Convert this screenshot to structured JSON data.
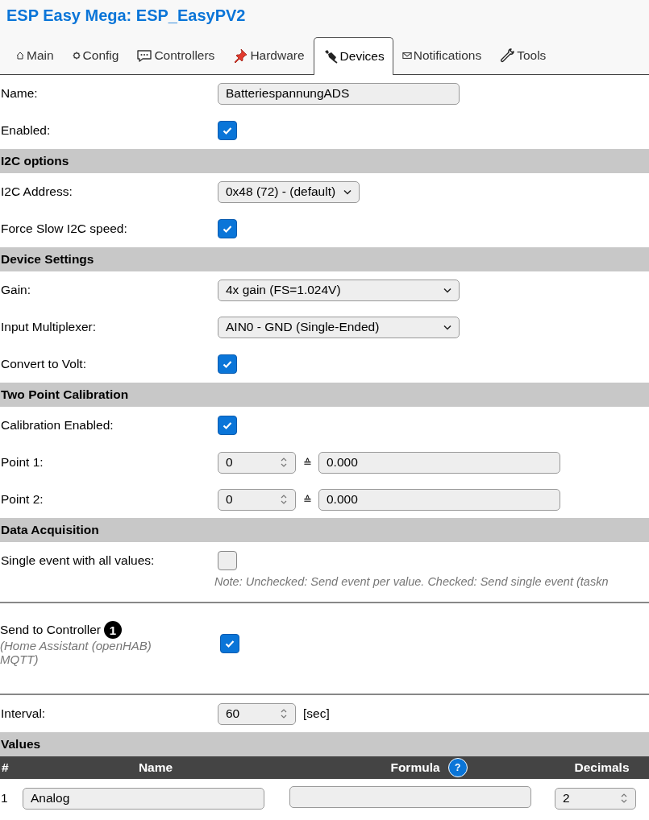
{
  "title": "ESP Easy Mega: ESP_EasyPV2",
  "tabs": [
    {
      "label": "Main",
      "selected": false
    },
    {
      "label": "Config",
      "selected": false
    },
    {
      "label": "Controllers",
      "selected": false
    },
    {
      "label": "Hardware",
      "selected": false
    },
    {
      "label": "Devices",
      "selected": true
    },
    {
      "label": "Notifications",
      "selected": false
    },
    {
      "label": "Tools",
      "selected": false
    }
  ],
  "form": [
    {
      "kind": "text",
      "label": "Name:",
      "value": "BatteriespannungADS"
    },
    {
      "kind": "checkbox",
      "label": "Enabled:",
      "checked": true
    },
    {
      "kind": "section",
      "label": "I2C options"
    },
    {
      "kind": "select",
      "label": "I2C Address:",
      "value": "0x48 (72) - (default)",
      "wide": false
    },
    {
      "kind": "checkbox",
      "label": "Force Slow I2C speed:",
      "checked": true
    },
    {
      "kind": "section",
      "label": "Device Settings"
    },
    {
      "kind": "select",
      "label": "Gain:",
      "value": "4x gain (FS=1.024V)",
      "wide": true
    },
    {
      "kind": "select",
      "label": "Input Multiplexer:",
      "value": "AIN0 - GND (Single-Ended)",
      "wide": true
    },
    {
      "kind": "checkbox",
      "label": "Convert to Volt:",
      "checked": true
    },
    {
      "kind": "section",
      "label": "Two Point Calibration"
    },
    {
      "kind": "checkbox",
      "label": "Calibration Enabled:",
      "checked": true
    },
    {
      "kind": "point",
      "label": "Point 1:",
      "value": "0",
      "sign": "≙",
      "reading": "0.000"
    },
    {
      "kind": "point",
      "label": "Point 2:",
      "value": "0",
      "sign": "≙",
      "reading": "0.000"
    },
    {
      "kind": "section",
      "label": "Data Acquisition"
    },
    {
      "kind": "checkbox",
      "label": "Single event with all values:",
      "checked": false
    },
    {
      "kind": "note",
      "text": "Note: Unchecked: Send event per value. Checked: Send single event (taskn"
    },
    {
      "kind": "controller",
      "label": "Send to Controller",
      "badge": "1",
      "detail": "(Home Assistant (openHAB) MQTT)",
      "checked": true
    },
    {
      "kind": "number",
      "label": "Interval:",
      "value": "60",
      "unit": "[sec]"
    },
    {
      "kind": "section",
      "label": "Values"
    }
  ],
  "values_table": {
    "columns": [
      {
        "label": "#"
      },
      {
        "label": "Name"
      },
      {
        "label": "Formula",
        "help": "?"
      },
      {
        "label": "Decimals"
      }
    ],
    "rows": [
      {
        "index": "1",
        "name": "Analog",
        "decimals": "2"
      }
    ]
  }
}
